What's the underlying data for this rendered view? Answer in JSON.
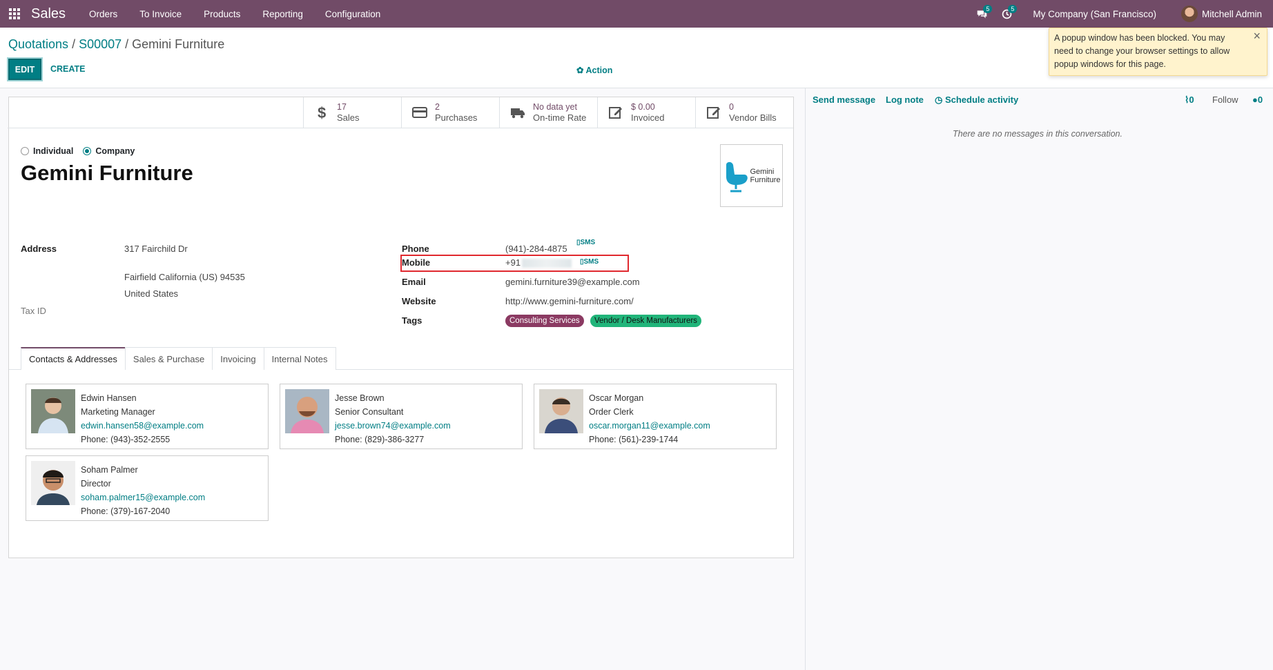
{
  "navbar": {
    "app_name": "Sales",
    "menu": [
      "Orders",
      "To Invoice",
      "Products",
      "Reporting",
      "Configuration"
    ],
    "messages_count": "5",
    "activities_count": "5",
    "company": "My Company (San Francisco)",
    "user": "Mitchell Admin"
  },
  "breadcrumb": {
    "parent": "Quotations",
    "order": "S00007",
    "current": "Gemini Furniture",
    "separator": "/"
  },
  "toolbar": {
    "edit_label": "EDIT",
    "create_label": "CREATE",
    "action_label": "Action"
  },
  "notification": {
    "text": "A popup window has been blocked. You may need to change your browser settings to allow popup windows for this page.",
    "close": "×"
  },
  "smart_buttons": [
    {
      "value": "17",
      "label": "Sales",
      "icon": "dollar-icon"
    },
    {
      "value": "2",
      "label": "Purchases",
      "icon": "credit-card-icon"
    },
    {
      "value": "No data yet",
      "label": "On-time Rate",
      "icon": "truck-icon"
    },
    {
      "value": "$ 0.00",
      "label": "Invoiced",
      "icon": "edit-icon"
    },
    {
      "value": "0",
      "label": "Vendor Bills",
      "icon": "edit-icon"
    }
  ],
  "partner": {
    "type_individual": "Individual",
    "type_company": "Company",
    "name": "Gemini Furniture",
    "logo_line1": "Gemini",
    "logo_line2": "Furniture"
  },
  "fields": {
    "address_label": "Address",
    "street": "317 Fairchild Dr",
    "city_line": "Fairfield  California (US)  94535",
    "country": "United States",
    "tax_id_label": "Tax ID",
    "phone_label": "Phone",
    "phone": "(941)-284-4875",
    "sms": "SMS",
    "mobile_label": "Mobile",
    "mobile_prefix": "+91",
    "email_label": "Email",
    "email": "gemini.furniture39@example.com",
    "website_label": "Website",
    "website": "http://www.gemini-furniture.com/",
    "tags_label": "Tags",
    "tags": [
      {
        "name": "Consulting Services",
        "color": "#8b3a62"
      },
      {
        "name": "Vendor / Desk Manufacturers",
        "color": "#21b57a"
      }
    ]
  },
  "tabs": [
    "Contacts & Addresses",
    "Sales & Purchase",
    "Invoicing",
    "Internal Notes"
  ],
  "contacts": [
    {
      "name": "Edwin Hansen",
      "role": "Marketing Manager",
      "email": "edwin.hansen58@example.com",
      "phone": "Phone: (943)-352-2555"
    },
    {
      "name": "Jesse Brown",
      "role": "Senior Consultant",
      "email": "jesse.brown74@example.com",
      "phone": "Phone: (829)-386-3277"
    },
    {
      "name": "Oscar Morgan",
      "role": "Order Clerk",
      "email": "oscar.morgan11@example.com",
      "phone": "Phone: (561)-239-1744"
    },
    {
      "name": "Soham Palmer",
      "role": "Director",
      "email": "soham.palmer15@example.com",
      "phone": "Phone: (379)-167-2040"
    }
  ],
  "chatter": {
    "send_message": "Send message",
    "log_note": "Log note",
    "schedule_activity": "Schedule activity",
    "attachments_count": "0",
    "follow": "Follow",
    "followers_count": "0",
    "empty_text": "There are no messages in this conversation."
  }
}
